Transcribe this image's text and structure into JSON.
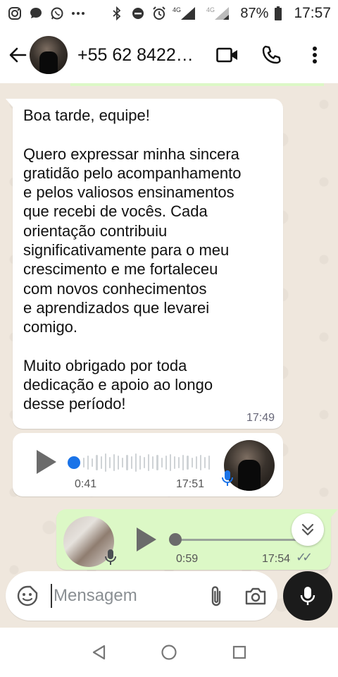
{
  "status_bar": {
    "network_label": "4G",
    "network_label_2": "4G",
    "battery": "87%",
    "time": "17:57",
    "icons": [
      "instagram-icon",
      "chat-icon",
      "whatsapp-icon",
      "more-icon",
      "bluetooth-icon",
      "dnd-icon",
      "alarm-icon",
      "signal-icon",
      "battery-icon"
    ]
  },
  "header": {
    "contact_name": "+55 62 8422…",
    "icons": [
      "back-arrow-icon",
      "video-call-icon",
      "phone-icon",
      "more-vertical-icon"
    ]
  },
  "messages": [
    {
      "type": "text",
      "direction": "incoming",
      "text": "Boa tarde, equipe!\n\nQuero expressar minha sincera\ngratidão pelo acompanhamento\ne pelos valiosos ensinamentos\nque recebi de vocês. Cada\norientação contribuiu\nsignificativamente para o meu\ncrescimento e me fortaleceu\ncom novos conhecimentos\ne aprendizados que levarei\ncomigo.\n\nMuito obrigado por toda\ndedicação e apoio ao longo\ndesse período!",
      "time": "17:49"
    },
    {
      "type": "voice",
      "direction": "incoming",
      "duration": "0:41",
      "time": "17:51",
      "progress": 0
    },
    {
      "type": "voice",
      "direction": "outgoing",
      "duration": "0:59",
      "time": "17:54",
      "read_receipt": "✓✓",
      "progress": 0
    }
  ],
  "composer": {
    "placeholder": "Mensagem"
  },
  "colors": {
    "chat_bg": "#efe7dd",
    "outgoing_bubble": "#dcf8c6",
    "voice_knob_blue": "#1a73e8",
    "read_tick": "#6f7d86"
  }
}
